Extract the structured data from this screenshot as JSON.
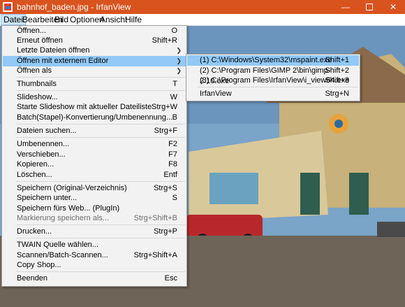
{
  "window": {
    "title": "bahnhof_baden.jpg - IrfanView",
    "minimize_icon": "minimize-icon",
    "maximize_icon": "maximize-icon",
    "close_icon": "close-icon",
    "accent": "#d9531e"
  },
  "menubar": {
    "items": [
      "Datei",
      "Bearbeiten",
      "Bild",
      "Optionen",
      "Ansicht",
      "Hilfe"
    ],
    "active": "Datei"
  },
  "file_menu": {
    "items": [
      {
        "label": "Öffnen...",
        "shortcut": "O"
      },
      {
        "label": "Erneut öffnen",
        "shortcut": "Shift+R"
      },
      {
        "label": "Letzte Dateien öffnen",
        "shortcut": ""
      },
      {
        "label": "Öffnen mit externem Editor",
        "shortcut": ""
      },
      {
        "label": "Öffnen als",
        "shortcut": ""
      },
      {
        "label": "Thumbnails",
        "shortcut": "T"
      },
      {
        "label": "Slideshow...",
        "shortcut": "W"
      },
      {
        "label": "Starte Slideshow mit aktueller Dateiliste",
        "shortcut": "Strg+W"
      },
      {
        "label": "Batch(Stapel)-Konvertierung/Umbenennung...",
        "shortcut": "B"
      },
      {
        "label": "Dateien suchen...",
        "shortcut": "Strg+F"
      },
      {
        "label": "Umbenennen...",
        "shortcut": "F2"
      },
      {
        "label": "Verschieben...",
        "shortcut": "F7"
      },
      {
        "label": "Kopieren...",
        "shortcut": "F8"
      },
      {
        "label": "Löschen...",
        "shortcut": "Entf"
      },
      {
        "label": "Speichern (Original-Verzeichnis)",
        "shortcut": "Strg+S"
      },
      {
        "label": "Speichern unter...",
        "shortcut": "S"
      },
      {
        "label": "Speichern fürs Web... (PlugIn)",
        "shortcut": ""
      },
      {
        "label": "Markierung speichern als...",
        "shortcut": "Strg+Shift+B"
      },
      {
        "label": "Drucken...",
        "shortcut": "Strg+P"
      },
      {
        "label": "TWAIN Quelle wählen...",
        "shortcut": ""
      },
      {
        "label": "Scannen/Batch-Scannen...",
        "shortcut": "Strg+Shift+A"
      },
      {
        "label": "Copy Shop...",
        "shortcut": ""
      },
      {
        "label": "Beenden",
        "shortcut": "Esc"
      }
    ]
  },
  "submenu": {
    "items": [
      {
        "label": "(1) C:\\Windows\\System32\\mspaint.exe",
        "shortcut": "Shift+1"
      },
      {
        "label": "(2) C:\\Program Files\\GIMP 2\\bin\\gimp-2.10.exe",
        "shortcut": "Shift+2"
      },
      {
        "label": "(3) C:\\Program Files\\IrfanView\\i_view64.exe",
        "shortcut": "Shift+3"
      },
      {
        "label": "IrfanView",
        "shortcut": "Strg+N"
      }
    ]
  },
  "icons": {
    "app_icon": "irfanview-app-icon",
    "submenu_arrow": "chevron-right-icon"
  }
}
